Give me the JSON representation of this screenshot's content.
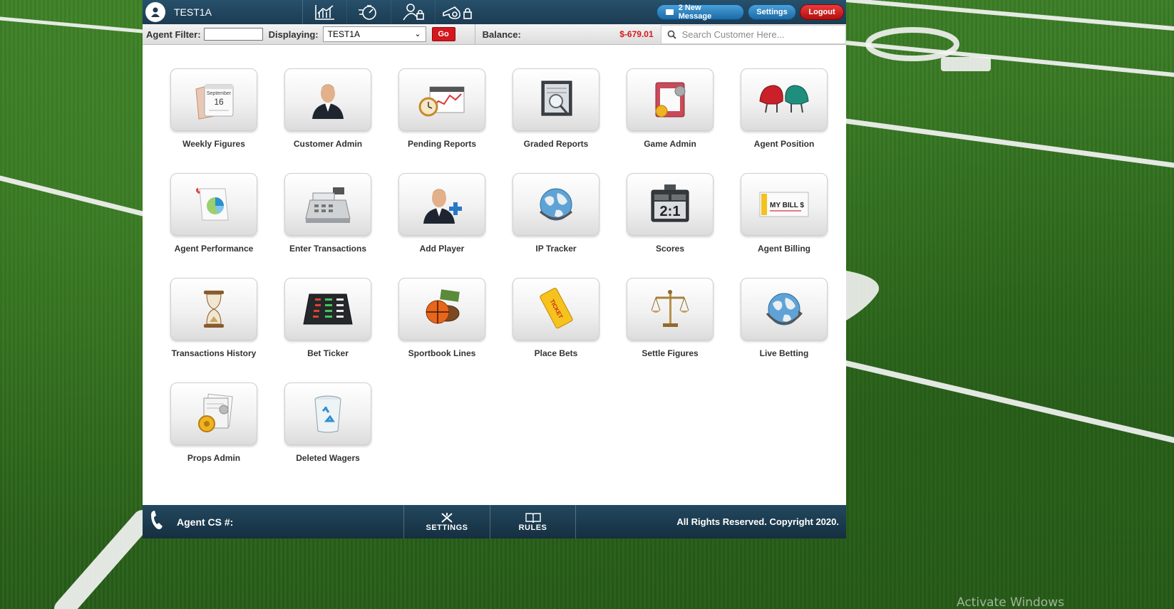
{
  "header": {
    "username": "TEST1A",
    "nav_icons": [
      "chart-icon",
      "stopwatch-icon",
      "user-lock-icon",
      "whistle-lock-icon"
    ],
    "messages_label": "2 New Message",
    "settings_label": "Settings",
    "logout_label": "Logout"
  },
  "filter": {
    "agent_filter_label": "Agent Filter:",
    "agent_filter_value": "",
    "displaying_label": "Displaying:",
    "displaying_value": "TEST1A",
    "go_label": "Go",
    "balance_label": "Balance:",
    "balance_value": "$-679.01",
    "search_placeholder": "Search Customer Here..."
  },
  "tiles": [
    {
      "label": "Weekly Figures",
      "icon": "calendar-icon"
    },
    {
      "label": "Customer Admin",
      "icon": "customer-icon"
    },
    {
      "label": "Pending Reports",
      "icon": "pending-reports-icon"
    },
    {
      "label": "Graded Reports",
      "icon": "graded-reports-icon"
    },
    {
      "label": "Game Admin",
      "icon": "game-admin-icon"
    },
    {
      "label": "Agent Position",
      "icon": "helmets-icon"
    },
    {
      "label": "Agent Performance",
      "icon": "pie-chart-icon"
    },
    {
      "label": "Enter Transactions",
      "icon": "cash-register-icon"
    },
    {
      "label": "Add Player",
      "icon": "add-player-icon"
    },
    {
      "label": "IP Tracker",
      "icon": "globe-icon"
    },
    {
      "label": "Scores",
      "icon": "scoreboard-icon"
    },
    {
      "label": "Agent Billing",
      "icon": "bill-icon"
    },
    {
      "label": "Transactions History",
      "icon": "hourglass-icon"
    },
    {
      "label": "Bet Ticker",
      "icon": "ticker-board-icon"
    },
    {
      "label": "Sportbook Lines",
      "icon": "balls-icon"
    },
    {
      "label": "Place Bets",
      "icon": "ticket-icon"
    },
    {
      "label": "Settle Figures",
      "icon": "scales-icon"
    },
    {
      "label": "Live Betting",
      "icon": "globe-arrow-icon"
    },
    {
      "label": "Props Admin",
      "icon": "props-icon"
    },
    {
      "label": "Deleted Wagers",
      "icon": "trash-icon"
    }
  ],
  "tile_text": {
    "calendar_month": "September",
    "calendar_day": "16",
    "scoreboard_score": "2:1",
    "bill_text": "MY BILL $",
    "ticket_text": "TICKET"
  },
  "footer": {
    "cs_label": "Agent CS #:",
    "settings_label": "SETTINGS",
    "rules_label": "RULES",
    "copyright": "All Rights Reserved. Copyright 2020."
  },
  "watermark": "Activate Windows",
  "colors": {
    "header_bg": "#1c3c52",
    "accent_blue": "#1b6aa8",
    "accent_red": "#d5161c",
    "field_green": "#2f6b1c"
  }
}
